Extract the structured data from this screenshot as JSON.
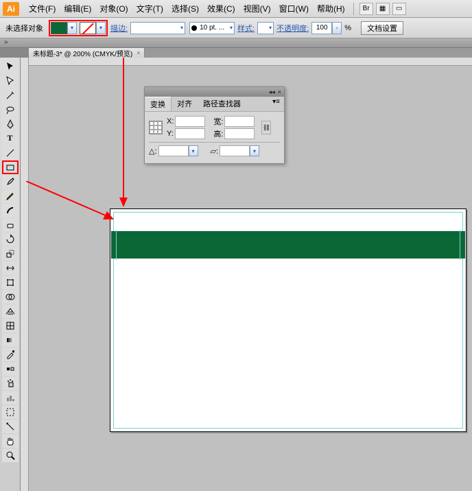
{
  "menubar": {
    "logo": "Ai",
    "items": [
      "文件(F)",
      "编辑(E)",
      "对象(O)",
      "文字(T)",
      "选择(S)",
      "效果(C)",
      "视图(V)",
      "窗口(W)",
      "帮助(H)"
    ],
    "bridge_icon": "Br"
  },
  "controlbar": {
    "status": "未选择对象",
    "stroke_label": "描边:",
    "stroke_weight": "10 pt. ...",
    "style_label": "样式:",
    "opacity_label": "不透明度:",
    "opacity_value": "100",
    "opacity_unit": "%",
    "doc_setup": "文档设置"
  },
  "doctab": {
    "title": "未标题-3* @ 200% (CMYK/预览)"
  },
  "panel": {
    "tabs": [
      "变换",
      "对齐",
      "路径查找器"
    ],
    "x_label": "X:",
    "y_label": "Y:",
    "w_label": "宽:",
    "h_label": "高:",
    "rotate_label": "△:",
    "shear_label": "▱:"
  },
  "colors": {
    "fill": "#0b6836",
    "highlight": "#ff0000"
  }
}
